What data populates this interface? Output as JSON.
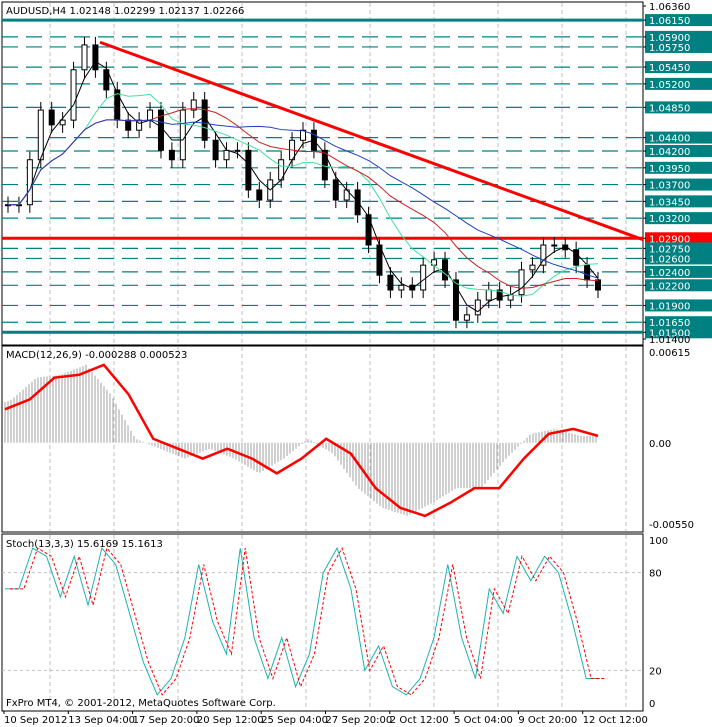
{
  "chart_data": {
    "type": "candlestick",
    "symbol_info": "AUDUSD,H4  1.02148 1.02299 1.02137 1.02266",
    "price_range": [
      1.014,
      1.0636
    ],
    "price_labels": [
      "1.06360",
      "1.06150",
      "1.05900",
      "1.05750",
      "1.05450",
      "1.05200",
      "1.04850",
      "1.04400",
      "1.04200",
      "1.03950",
      "1.03700",
      "1.03450",
      "1.03200",
      "1.02900",
      "1.02750",
      "1.02600",
      "1.02400",
      "1.02200",
      "1.01900",
      "1.01650",
      "1.01500",
      "1.01400"
    ],
    "level_prices": [
      1.0615,
      1.059,
      1.0575,
      1.0545,
      1.052,
      1.0485,
      1.044,
      1.042,
      1.0395,
      1.037,
      1.0345,
      1.032,
      1.029,
      1.0275,
      1.026,
      1.024,
      1.022,
      1.019,
      1.0165,
      1.015
    ],
    "key_support": 1.015,
    "key_resistance_top": 1.0615,
    "horizontal_red": 1.029,
    "trendline": {
      "from": 1.0582,
      "to": 1.0288
    },
    "closes": [
      1.034,
      1.034,
      1.0407,
      1.0481,
      1.0459,
      1.0466,
      1.0541,
      1.0578,
      1.0541,
      1.0511,
      1.0466,
      1.0451,
      1.0466,
      1.0481,
      1.0421,
      1.0407,
      1.0481,
      1.0496,
      1.0436,
      1.0407,
      1.0421,
      1.0421,
      1.0362,
      1.0347,
      1.0377,
      1.0407,
      1.0436,
      1.0451,
      1.0421,
      1.0377,
      1.0347,
      1.0362,
      1.0325,
      1.028,
      1.0235,
      1.0213,
      1.022,
      1.0213,
      1.025,
      1.0258,
      1.0228,
      1.0168,
      1.0176,
      1.0198,
      1.0213,
      1.0198,
      1.0206,
      1.0243,
      1.025,
      1.028,
      1.028,
      1.0273,
      1.025,
      1.0228,
      1.0213
    ],
    "time_labels": [
      "10 Sep 2012",
      "13 Sep 04:00",
      "17 Sep 20:00",
      "20 Sep 12:00",
      "25 Sep 04:00",
      "27 Sep 20:00",
      "2 Oct 12:00",
      "5 Oct 04:00",
      "9 Oct 20:00",
      "12 Oct 12:00"
    ],
    "macd": {
      "title": "MACD(12,26,9) -0.000288 0.000523",
      "range": [
        -0.0055,
        0.00615
      ],
      "labels": [
        "0.00615",
        "0.00",
        "-0.00550"
      ],
      "signal": [
        0.00227,
        0.00294,
        0.00441,
        0.00461,
        0.00528,
        0.00328,
        0.00027,
        -0.0004,
        -0.00107,
        -0.0004,
        -0.00107,
        -0.00207,
        -0.00107,
        0.00027,
        -0.00074,
        -0.00307,
        -0.00441,
        -0.00495,
        -0.00408,
        -0.00307,
        -0.00307,
        -0.00107,
        0.0006,
        0.00094,
        0.00047
      ]
    },
    "stoch": {
      "title": "Stoch(13,3,3) 15.6169 15.1613",
      "labels": [
        "100",
        "80",
        "20",
        "0"
      ],
      "main": [
        70,
        70,
        95,
        90,
        65,
        90,
        60,
        95,
        85,
        55,
        25,
        5,
        15,
        40,
        85,
        50,
        30,
        95,
        40,
        15,
        40,
        10,
        30,
        80,
        95,
        70,
        20,
        35,
        10,
        5,
        15,
        40,
        85,
        40,
        15,
        70,
        55,
        90,
        75,
        90,
        80,
        50,
        15,
        15
      ]
    },
    "copyright": "FxPro MT4, © 2001-2012, MetaQuotes Software Corp."
  }
}
